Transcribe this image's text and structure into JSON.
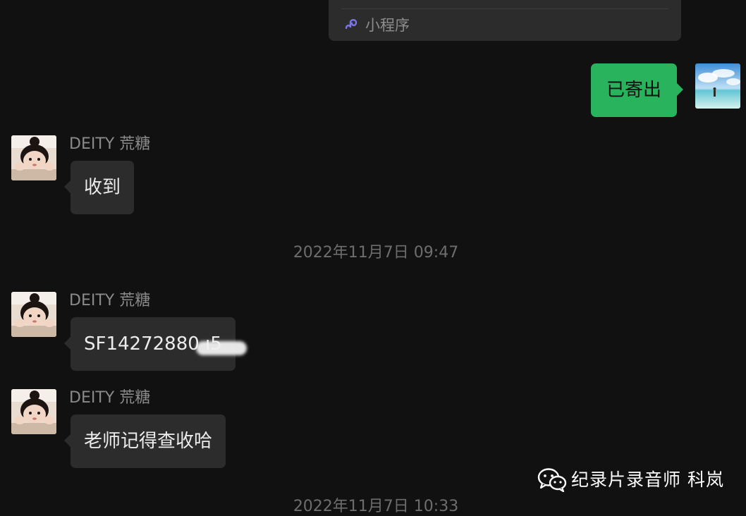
{
  "mini_program_card": {
    "label": "小程序"
  },
  "outgoing": [
    {
      "text": "已寄出"
    }
  ],
  "incoming": [
    {
      "sender": "DEITY 荒糖",
      "text": "收到"
    },
    {
      "sender": "DEITY 荒糖",
      "text": "SF14272880     ı5"
    },
    {
      "sender": "DEITY 荒糖",
      "text": "老师记得查收哈"
    }
  ],
  "timestamps": [
    "2022年11月7日 09:47",
    "2022年11月7日 10:33"
  ],
  "watermark": {
    "text": "纪录片录音师 科岚",
    "icon": "wechat-icon"
  },
  "colors": {
    "background": "#111111",
    "outgoing_bubble": "#29b35c",
    "incoming_bubble": "#2c2c2c",
    "mini_program_icon": "#7b73e8"
  }
}
